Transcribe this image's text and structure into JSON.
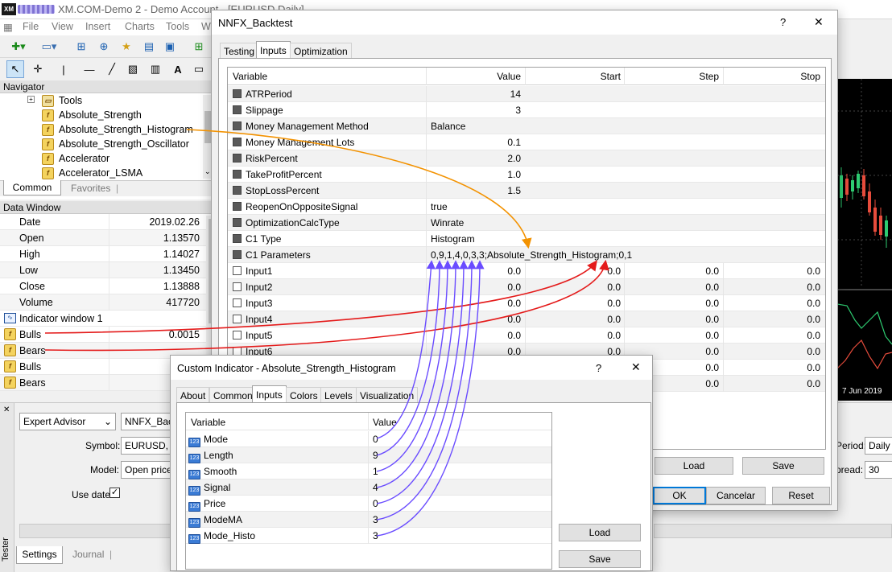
{
  "app": {
    "title": "XM.COM-Demo 2 - Demo Account - [EURUSD,Daily]",
    "logo": "XM"
  },
  "menu": [
    "File",
    "View",
    "Insert",
    "Charts",
    "Tools",
    "W"
  ],
  "navigator": {
    "title": "Navigator",
    "items": [
      "Tools",
      "Absolute_Strength",
      "Absolute_Strength_Histogram",
      "Absolute_Strength_Oscillator",
      "Accelerator",
      "Accelerator_LSMA"
    ],
    "tabs": [
      "Common",
      "Favorites"
    ]
  },
  "data_window": {
    "title": "Data Window",
    "rows": [
      {
        "k": "Date",
        "v": "2019.02.26"
      },
      {
        "k": "Open",
        "v": "1.13570"
      },
      {
        "k": "High",
        "v": "1.14027"
      },
      {
        "k": "Low",
        "v": "1.13450"
      },
      {
        "k": "Close",
        "v": "1.13888"
      },
      {
        "k": "Volume",
        "v": "417720"
      }
    ],
    "indicator_window": "Indicator window 1",
    "ind_rows": [
      {
        "k": "Bulls",
        "v": "0.0015"
      },
      {
        "k": "Bears",
        "v": ""
      },
      {
        "k": "Bulls",
        "v": ""
      },
      {
        "k": "Bears",
        "v": ""
      }
    ]
  },
  "tester": {
    "side_label": "Tester",
    "type": "Expert Advisor",
    "ea_name": "NNFX_Back",
    "symbol_label": "Symbol:",
    "symbol": "EURUSD, E",
    "model_label": "Model:",
    "model": "Open prices",
    "use_date": "Use date",
    "tabs": [
      "Settings",
      "Journal"
    ],
    "period_label": "Period:",
    "period": "Daily",
    "spread_label": "pread:",
    "spread": "30"
  },
  "chart": {
    "date_label": "7 Jun 2019"
  },
  "backtest": {
    "title": "NNFX_Backtest",
    "help": "?",
    "close": "✕",
    "tabs": [
      "Testing",
      "Inputs",
      "Optimization"
    ],
    "headers": [
      "Variable",
      "Value",
      "Start",
      "Step",
      "Stop"
    ],
    "rows": [
      {
        "name": "ATRPeriod",
        "value": "14"
      },
      {
        "name": "Slippage",
        "value": "3"
      },
      {
        "name": "Money Management Method",
        "value": "Balance"
      },
      {
        "name": "Money Management Lots",
        "value": "0.1"
      },
      {
        "name": "RiskPercent",
        "value": "2.0"
      },
      {
        "name": "TakeProfitPercent",
        "value": "1.0"
      },
      {
        "name": "StopLossPercent",
        "value": "1.5"
      },
      {
        "name": "ReopenOnOppositeSignal",
        "value": "true"
      },
      {
        "name": "OptimizationCalcType",
        "value": "Winrate"
      },
      {
        "name": "C1 Type",
        "value": "Histogram"
      },
      {
        "name": "C1 Parameters",
        "value": "0,9,1,4,0,3,3;Absolute_Strength_Histogram;0,1"
      },
      {
        "name": "Input1",
        "value": "0.0",
        "start": "0.0",
        "step": "0.0",
        "stop": "0.0"
      },
      {
        "name": "Input2",
        "value": "0.0",
        "start": "0.0",
        "step": "0.0",
        "stop": "0.0"
      },
      {
        "name": "Input3",
        "value": "0.0",
        "start": "0.0",
        "step": "0.0",
        "stop": "0.0"
      },
      {
        "name": "Input4",
        "value": "0.0",
        "start": "0.0",
        "step": "0.0",
        "stop": "0.0"
      },
      {
        "name": "Input5",
        "value": "0.0",
        "start": "0.0",
        "step": "0.0",
        "stop": "0.0"
      },
      {
        "name": "Input6",
        "value": "0.0",
        "start": "0.0",
        "step": "0.0",
        "stop": "0.0"
      },
      {
        "name": "",
        "value": "",
        "start": "",
        "step": "0.0",
        "stop": "0.0"
      },
      {
        "name": "",
        "value": "",
        "start": "",
        "step": "0.0",
        "stop": "0.0"
      }
    ],
    "buttons": {
      "load": "Load",
      "save": "Save",
      "ok": "OK",
      "cancel": "Cancelar",
      "reset": "Reset"
    }
  },
  "custom": {
    "title": "Custom Indicator - Absolute_Strength_Histogram",
    "help": "?",
    "close": "✕",
    "tabs": [
      "About",
      "Common",
      "Inputs",
      "Colors",
      "Levels",
      "Visualization"
    ],
    "headers": [
      "Variable",
      "Value"
    ],
    "rows": [
      {
        "name": "Mode",
        "value": "0"
      },
      {
        "name": "Length",
        "value": "9"
      },
      {
        "name": "Smooth",
        "value": "1"
      },
      {
        "name": "Signal",
        "value": "4"
      },
      {
        "name": "Price",
        "value": "0"
      },
      {
        "name": "ModeMA",
        "value": "3"
      },
      {
        "name": "Mode_Histo",
        "value": "3"
      }
    ],
    "buttons": {
      "load": "Load",
      "save": "Save"
    }
  },
  "colors": {
    "orange_arrow": "#f39200",
    "red_arrow": "#e41b1b",
    "purple_arrow": "#6a4cff",
    "accent": "#0078d7"
  }
}
